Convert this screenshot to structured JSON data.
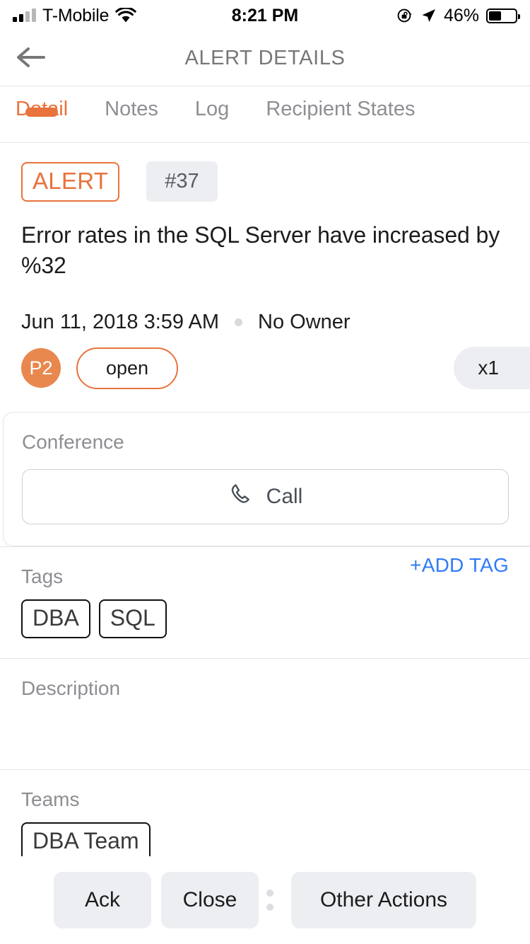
{
  "status_bar": {
    "carrier": "T-Mobile",
    "time": "8:21 PM",
    "battery_percent": "46%",
    "battery_level": 46,
    "signal_icon": "cellular-signal-icon",
    "wifi_icon": "wifi-icon",
    "rotation_lock_icon": "rotation-lock-icon",
    "location_icon": "location-arrow-icon",
    "battery_icon": "battery-icon"
  },
  "navbar": {
    "title": "ALERT DETAILS",
    "back_icon": "back-arrow-icon"
  },
  "tabs": [
    {
      "label": "Detail",
      "active": true
    },
    {
      "label": "Notes",
      "active": false
    },
    {
      "label": "Log",
      "active": false
    },
    {
      "label": "Recipient States",
      "active": false
    }
  ],
  "alert": {
    "type_badge": "ALERT",
    "id_badge": "#37",
    "message": "Error rates in the SQL Server have increased by %32",
    "timestamp": "Jun 11, 2018 3:59 AM",
    "owner": "No Owner",
    "priority": "P2",
    "state": "open",
    "count": "x1"
  },
  "conference": {
    "label": "Conference",
    "call_label": "Call",
    "call_icon": "phone-icon"
  },
  "tags": {
    "label": "Tags",
    "add_label": "+ADD TAG",
    "items": [
      "DBA",
      "SQL"
    ]
  },
  "description": {
    "label": "Description",
    "value": ""
  },
  "teams": {
    "label": "Teams",
    "items": [
      "DBA Team"
    ]
  },
  "actions": {
    "ack": "Ack",
    "close": "Close",
    "other": "Other Actions"
  },
  "colors": {
    "accent_orange": "#e8733c",
    "priority_orange": "#e8884f",
    "link_blue": "#2f7cf6",
    "muted_grey": "#8e8e93",
    "chip_grey": "#edeef2"
  }
}
